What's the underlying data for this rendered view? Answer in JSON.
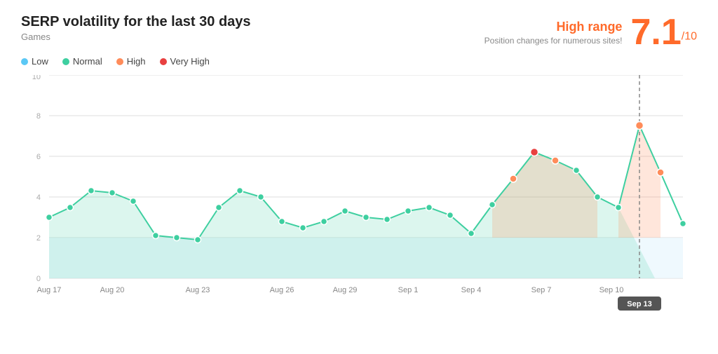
{
  "header": {
    "title": "SERP volatility for the last 30 days",
    "subtitle": "Games",
    "range_title": "High range",
    "range_desc": "Position changes for numerous sites!",
    "score": "7.1",
    "score_denom": "/10"
  },
  "legend": {
    "items": [
      {
        "label": "Low",
        "color_class": "dot-low"
      },
      {
        "label": "Normal",
        "color_class": "dot-normal"
      },
      {
        "label": "High",
        "color_class": "dot-high"
      },
      {
        "label": "Very High",
        "color_class": "dot-veryhigh"
      }
    ]
  },
  "chart": {
    "x_labels": [
      "Aug 17",
      "Aug 20",
      "Aug 23",
      "Aug 26",
      "Aug 29",
      "Sep 1",
      "Sep 4",
      "Sep 7",
      "Sep 10",
      "Sep 13"
    ],
    "y_labels": [
      "0",
      "2",
      "4",
      "6",
      "8",
      "10"
    ],
    "current_date": "Sep 13"
  }
}
